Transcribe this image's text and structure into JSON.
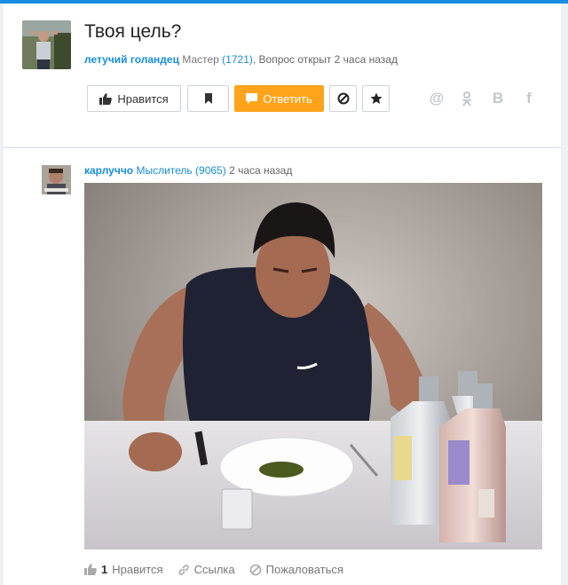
{
  "question": {
    "title": "Твоя цель?",
    "author": "летучий голандец",
    "rank": "Мастер",
    "rank_points": "(1721)",
    "status": ", Вопрос открыт 2 часа назад"
  },
  "actions": {
    "like_label": "Нравится",
    "answer_label": "Ответить"
  },
  "share": {
    "mail_icon": "at-icon",
    "ok_icon": "odnoklassniki-icon",
    "vk_label": "В",
    "fb_label": "f"
  },
  "answer": {
    "author": "карлуччо",
    "rank": "Мыслитель",
    "rank_points": "(9065)",
    "time": "2 часа назад",
    "like_count": "1",
    "like_label": "Нравится",
    "link_label": "Ссылка",
    "report_label": "Пожаловаться"
  },
  "colors": {
    "accent": "#168de2",
    "answer_button": "#ffa31a"
  }
}
